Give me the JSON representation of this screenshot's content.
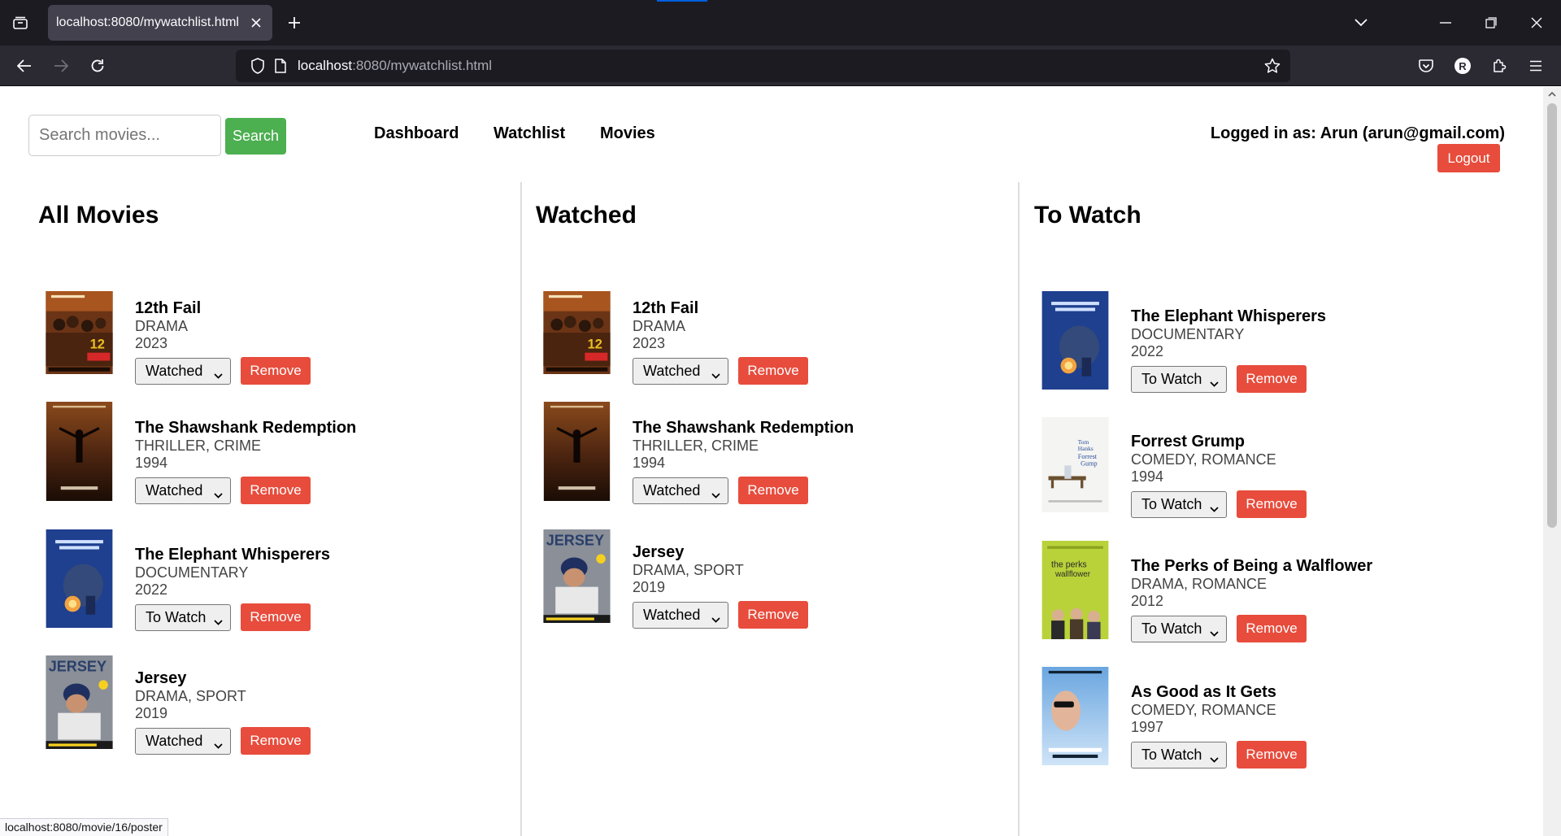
{
  "browser": {
    "tab_title": "localhost:8080/mywatchlist.html",
    "url_host": "localhost",
    "url_rest": ":8080/mywatchlist.html",
    "status_url": "localhost:8080/movie/16/poster",
    "profile_initial": "R"
  },
  "header": {
    "search_placeholder": "Search movies...",
    "search_button": "Search",
    "nav": [
      "Dashboard",
      "Watchlist",
      "Movies"
    ],
    "logged_in": "Logged in as: Arun (arun@gmail.com)",
    "logout_button": "Logout"
  },
  "columns": [
    {
      "title": "All Movies",
      "movies": [
        {
          "title": "12th Fail",
          "genre": "DRAMA",
          "year": "2023",
          "status": "Watched",
          "remove": "Remove",
          "poster": "twelfth-fail"
        },
        {
          "title": "The Shawshank Redemption",
          "genre": "THRILLER, CRIME",
          "year": "1994",
          "status": "Watched",
          "remove": "Remove",
          "poster": "shawshank"
        },
        {
          "title": "The Elephant Whisperers",
          "genre": "DOCUMENTARY",
          "year": "2022",
          "status": "To Watch",
          "remove": "Remove",
          "poster": "elephant"
        },
        {
          "title": "Jersey",
          "genre": "DRAMA, SPORT",
          "year": "2019",
          "status": "Watched",
          "remove": "Remove",
          "poster": "jersey"
        }
      ]
    },
    {
      "title": "Watched",
      "movies": [
        {
          "title": "12th Fail",
          "genre": "DRAMA",
          "year": "2023",
          "status": "Watched",
          "remove": "Remove",
          "poster": "twelfth-fail"
        },
        {
          "title": "The Shawshank Redemption",
          "genre": "THRILLER, CRIME",
          "year": "1994",
          "status": "Watched",
          "remove": "Remove",
          "poster": "shawshank"
        },
        {
          "title": "Jersey",
          "genre": "DRAMA, SPORT",
          "year": "2019",
          "status": "Watched",
          "remove": "Remove",
          "poster": "jersey"
        }
      ]
    },
    {
      "title": "To Watch",
      "movies": [
        {
          "title": "The Elephant Whisperers",
          "genre": "DOCUMENTARY",
          "year": "2022",
          "status": "To Watch",
          "remove": "Remove",
          "poster": "elephant"
        },
        {
          "title": "Forrest Grump",
          "genre": "COMEDY, ROMANCE",
          "year": "1994",
          "status": "To Watch",
          "remove": "Remove",
          "poster": "forrest"
        },
        {
          "title": "The Perks of Being a Walflower",
          "genre": "DRAMA, ROMANCE",
          "year": "2012",
          "status": "To Watch",
          "remove": "Remove",
          "poster": "perks"
        },
        {
          "title": "As Good as It Gets",
          "genre": "COMEDY, ROMANCE",
          "year": "1997",
          "status": "To Watch",
          "remove": "Remove",
          "poster": "as-good"
        }
      ]
    }
  ],
  "colors": {
    "search_button": "#4caf50",
    "danger": "#e74c3c",
    "chrome_dark": "#1c1b22",
    "chrome_toolbar": "#2b2a33"
  }
}
